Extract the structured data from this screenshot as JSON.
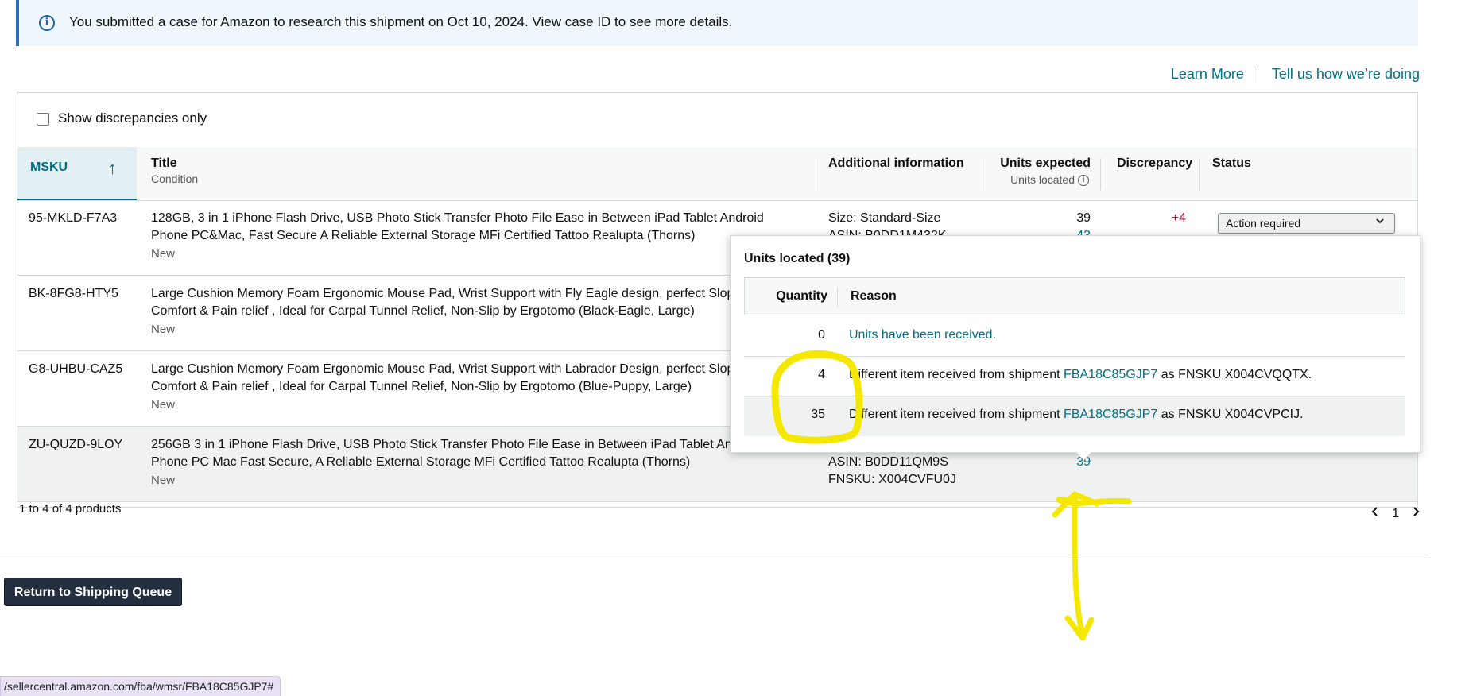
{
  "banner": {
    "icon": "info-icon",
    "text": "You submitted a case for Amazon to research this shipment on Oct 10, 2024. View case ID to see more details."
  },
  "links": {
    "learn_more": "Learn More",
    "feedback": "Tell us how we’re doing"
  },
  "filter": {
    "label": "Show discrepancies only",
    "checked": false
  },
  "table": {
    "headers": {
      "msku": "MSKU",
      "title": "Title",
      "title_sub": "Condition",
      "additional": "Additional information",
      "units_expected": "Units expected",
      "units_located": "Units located",
      "discrepancy": "Discrepancy",
      "status": "Status"
    },
    "rows": [
      {
        "msku": "95-MKLD-F7A3",
        "title_line1": "128GB, 3 in 1 iPhone Flash Drive, USB Photo Stick Transfer Photo File Ease in Between iPad Tablet Android",
        "title_line2": "Phone PC&Mac, Fast Secure A Reliable External Storage MFi Certified Tattoo Realupta (Thorns)",
        "condition": "New",
        "size": "Size: Standard-Size",
        "asin_partial": "ASIN: B0DD1M432K",
        "units_expected": "39",
        "units_located": "43",
        "discrepancy": "+4",
        "status": "Action required"
      },
      {
        "msku": "BK-8FG8-HTY5",
        "title_line1": "Large Cushion Memory Foam Ergonomic Mouse Pad, Wrist Support with Fly Eagle design, perfect Slop",
        "title_line2": "Comfort & Pain relief , Ideal for Carpal Tunnel Relief, Non-Slip by Ergotomo (Black-Eagle, Large)",
        "condition": "New"
      },
      {
        "msku": "G8-UHBU-CAZ5",
        "title_line1": "Large Cushion Memory Foam Ergonomic Mouse Pad, Wrist Support with Labrador Design, perfect Slop",
        "title_line2": "Comfort & Pain relief , Ideal for Carpal Tunnel Relief, Non-Slip by Ergotomo (Blue-Puppy, Large)",
        "condition": "New"
      },
      {
        "msku": "ZU-QUZD-9LOY",
        "title_line1": "256GB 3 in 1 iPhone Flash Drive, USB Photo Stick Transfer Photo File Ease in Between iPad Tablet And",
        "title_line2": "Phone PC Mac Fast Secure, A Reliable External Storage MFi Certified Tattoo Realupta (Thorns)",
        "condition": "New",
        "asin": "ASIN: B0DD11QM9S",
        "fnsku": "FNSKU: X004CVFU0J",
        "units_located": "39"
      }
    ]
  },
  "popover": {
    "title": "Units located (39)",
    "headers": {
      "quantity": "Quantity",
      "reason": "Reason"
    },
    "rows": [
      {
        "quantity": "0",
        "reason": "Units have been received."
      },
      {
        "quantity": "4",
        "reason_prefix": "Different item received from shipment",
        "shipment": "FBA18C85GJP7",
        "reason_suffix": "as FNSKU X004CVQQTX."
      },
      {
        "quantity": "35",
        "reason_prefix": "Different item received from shipment",
        "shipment": "FBA18C85GJP7",
        "reason_suffix": "as FNSKU X004CVPCIJ."
      }
    ]
  },
  "footer": {
    "count": "1 to 4 of 4 products",
    "page": "1"
  },
  "actions": {
    "return": "Return to Shipping Queue"
  },
  "status_bar": {
    "url": "/sellercentral.amazon.com/fba/wmsr/FBA18C85GJP7#"
  },
  "colors": {
    "link": "#007185",
    "annotation": "#f5e800",
    "discrepancy": "#cc0c39",
    "primary_button": "#232f3e"
  }
}
